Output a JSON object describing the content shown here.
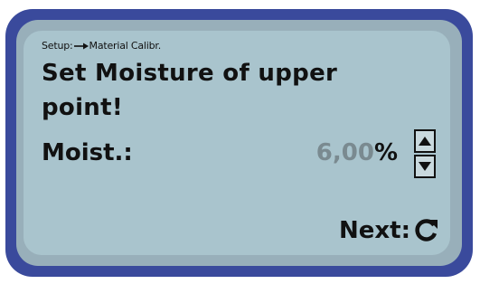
{
  "breadcrumb": {
    "prefix": "Setup:",
    "arrow_icon": "arrow-right-icon",
    "section": "Material Calibr."
  },
  "title": "Set Moisture of upper point!",
  "moisture": {
    "label": "Moist.:",
    "value": "6,00",
    "unit": "%",
    "up_icon": "triangle-up-icon",
    "down_icon": "triangle-down-icon"
  },
  "footer": {
    "next_label": "Next:",
    "next_icon": "refresh-icon"
  },
  "colors": {
    "bezel": "#3a4a9c",
    "screen_frame": "#98afba",
    "screen": "#a9c4cd",
    "value_gray": "#7a8a90"
  }
}
